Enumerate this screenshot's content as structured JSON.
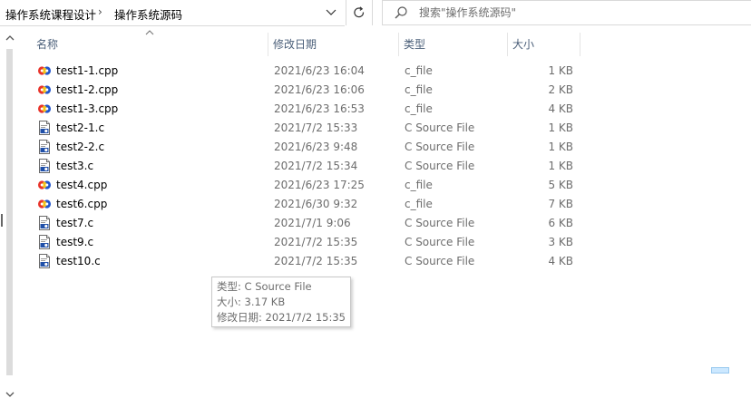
{
  "breadcrumb": {
    "parent": "操作系统课程设计",
    "separator": "›",
    "current": "操作系统源码"
  },
  "search": {
    "placeholder": "搜索\"操作系统源码\""
  },
  "columns": {
    "name": "名称",
    "date": "修改日期",
    "type": "类型",
    "size": "大小"
  },
  "files": [
    {
      "name": "test1-1.cpp",
      "date": "2021/6/23 16:04",
      "type": "c_file",
      "size": "1 KB",
      "icon": "cpp-file-icon"
    },
    {
      "name": "test1-2.cpp",
      "date": "2021/6/23 16:06",
      "type": "c_file",
      "size": "2 KB",
      "icon": "cpp-file-icon"
    },
    {
      "name": "test1-3.cpp",
      "date": "2021/6/23 16:53",
      "type": "c_file",
      "size": "4 KB",
      "icon": "cpp-file-icon"
    },
    {
      "name": "test2-1.c",
      "date": "2021/7/2 15:33",
      "type": "C Source File",
      "size": "1 KB",
      "icon": "c-file-icon"
    },
    {
      "name": "test2-2.c",
      "date": "2021/6/23 9:48",
      "type": "C Source File",
      "size": "1 KB",
      "icon": "c-file-icon"
    },
    {
      "name": "test3.c",
      "date": "2021/7/2 15:34",
      "type": "C Source File",
      "size": "1 KB",
      "icon": "c-file-icon"
    },
    {
      "name": "test4.cpp",
      "date": "2021/6/23 17:25",
      "type": "c_file",
      "size": "5 KB",
      "icon": "cpp-file-icon"
    },
    {
      "name": "test6.cpp",
      "date": "2021/6/30 9:32",
      "type": "c_file",
      "size": "7 KB",
      "icon": "cpp-file-icon"
    },
    {
      "name": "test7.c",
      "date": "2021/7/1 9:06",
      "type": "C Source File",
      "size": "6 KB",
      "icon": "c-file-icon"
    },
    {
      "name": "test9.c",
      "date": "2021/7/2 15:35",
      "type": "C Source File",
      "size": "3 KB",
      "icon": "c-file-icon"
    },
    {
      "name": "test10.c",
      "date": "2021/7/2 15:35",
      "type": "C Source File",
      "size": "4 KB",
      "icon": "c-file-icon"
    }
  ],
  "tooltip": {
    "type_line": "类型: C Source File",
    "size_line": "大小: 3.17 KB",
    "date_line": "修改日期: 2021/7/2 15:35"
  },
  "colors": {
    "header_text": "#4c607a",
    "secondary_text": "#6d6d6d",
    "cpp_icon_red": "#e8332a",
    "cpp_icon_blue": "#2255cc",
    "cpp_icon_yellow": "#f3c21a",
    "c_icon_blue": "#1f4fa8"
  }
}
